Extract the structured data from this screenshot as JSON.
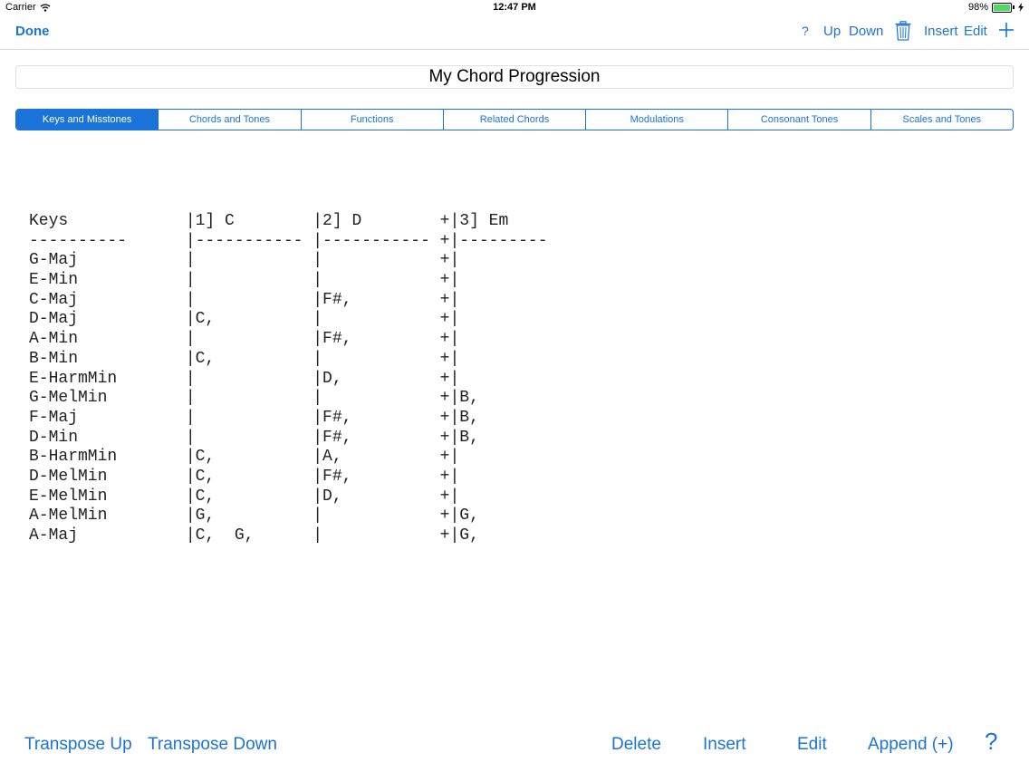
{
  "status_bar": {
    "carrier": "Carrier",
    "time": "12:47 PM",
    "battery_text": "98%",
    "battery_level": 0.98
  },
  "navbar": {
    "done": "Done",
    "help": "?",
    "up": "Up",
    "down": "Down",
    "insert": "Insert",
    "edit": "Edit"
  },
  "title": "My Chord Progression",
  "tabs": [
    {
      "label": "Keys and Misstones",
      "active": true
    },
    {
      "label": "Chords and Tones",
      "active": false
    },
    {
      "label": "Functions",
      "active": false
    },
    {
      "label": "Related Chords",
      "active": false
    },
    {
      "label": "Modulations",
      "active": false
    },
    {
      "label": "Consonant Tones",
      "active": false
    },
    {
      "label": "Scales and Tones",
      "active": false
    }
  ],
  "table_lines": [
    "Keys            |1] C        |2] D        +|3] Em",
    "----------      |----------- |----------- +|---------",
    "G-Maj           |            |            +|",
    "E-Min           |            |            +|",
    "C-Maj           |            |F#,         +|",
    "D-Maj           |C,          |            +|",
    "A-Min           |            |F#,         +|",
    "B-Min           |C,          |            +|",
    "E-HarmMin       |            |D,          +|",
    "G-MelMin        |            |            +|B,",
    "F-Maj           |            |F#,         +|B,",
    "D-Min           |            |F#,         +|B,",
    "B-HarmMin       |C,          |A,          +|",
    "D-MelMin        |C,          |F#,         +|",
    "E-MelMin        |C,          |D,          +|",
    "A-MelMin        |G,          |            +|G,",
    "A-Maj           |C,  G,      |            +|G,"
  ],
  "bottom_bar": {
    "transpose_up": "Transpose Up",
    "transpose_down": "Transpose Down",
    "delete": "Delete",
    "insert": "Insert",
    "edit": "Edit",
    "append": "Append (+)",
    "help": "?"
  },
  "colors": {
    "accent": "#1a73d9",
    "battery": "#4cd964"
  },
  "icons": {
    "wifi": "wifi-icon",
    "trash": "trash-icon",
    "plus": "plus-icon"
  }
}
